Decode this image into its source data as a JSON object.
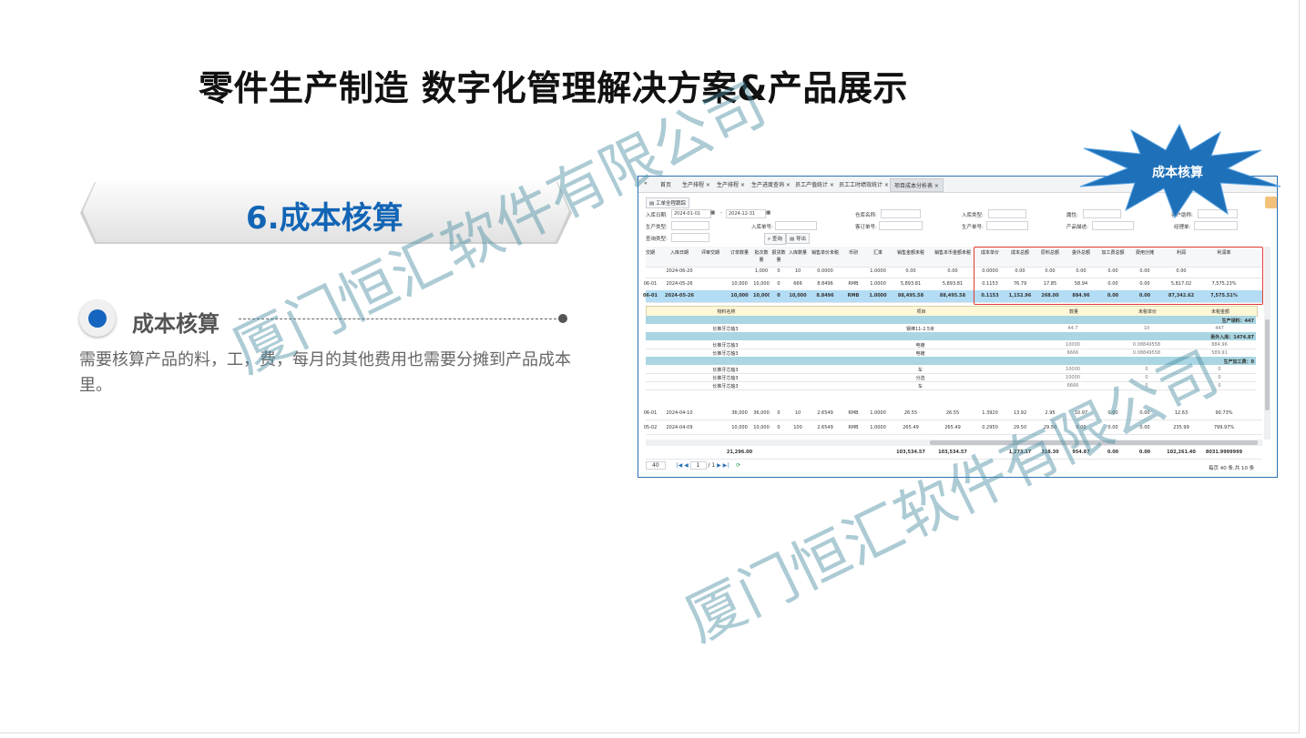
{
  "slide": {
    "title": "零件生产制造 数字化管理解决方案&产品展示",
    "section": "6.成本核算",
    "subheading": "成本核算",
    "description": "需要核算产品的料，工，费，每月的其他费用也需要分摊到产品成本里。",
    "watermark": "厦门恒汇软件有限公司",
    "colors": {
      "corner": "#4a8b94",
      "accent": "#1265b5",
      "highlight_box": "#e23a33",
      "star": "#1e70b8"
    }
  },
  "callout": {
    "label": "成本核算"
  },
  "screenshot": {
    "tabs": [
      "首页",
      "生产排程",
      "生产排程",
      "生产进度查询",
      "员工产值统计",
      "员工工时绩效统计",
      "项目成本分析表"
    ],
    "nav_icon": "«",
    "toolbar_button": "工单全程跟踪",
    "filters": {
      "date_label": "入库日期:",
      "date_from": "2024-01-01",
      "date_to": "2024-12-31",
      "warehouse_label": "仓库名称:",
      "instock_type_label": "入库类型:",
      "attribute_label": "属性:",
      "customer_label": "客户助称:",
      "prod_type_label": "生产类型:",
      "instock_no_label": "入库单号:",
      "order_no_label": "客订单号:",
      "prod_no_label": "生产单号:",
      "product_desc_label": "产品描述:",
      "manager_label": "经理单:",
      "query_type_label": "查询类型:",
      "search_button": "查询",
      "export_button": "导出"
    },
    "columns": [
      "交期",
      "入库日期",
      "评审交期",
      "订单数量",
      "批次数量",
      "报货数量",
      "入库数量",
      "销售单价未税",
      "币别",
      "汇率",
      "销售金额未税",
      "销售本币金额未税",
      "成本单价",
      "成本总额",
      "原料总额",
      "委外总额",
      "加工费总额",
      "费用分摊",
      "利润",
      "利润率"
    ],
    "rows": [
      {
        "cells": [
          "",
          "2024-06-20",
          "",
          "",
          "1,000",
          "0",
          "10",
          "0.0000",
          "",
          "1.0000",
          "0.00",
          "0.00",
          "0.0000",
          "0.00",
          "0.00",
          "0.00",
          "0.00",
          "0.00",
          "0.00",
          ""
        ]
      },
      {
        "cells": [
          "06-01",
          "2024-05-26",
          "",
          "10,000",
          "10,000",
          "0",
          "666",
          "8.8496",
          "RMB",
          "1.0000",
          "5,893.81",
          "5,893.81",
          "0.1153",
          "76.79",
          "17.85",
          "58.94",
          "0.00",
          "0.00",
          "5,817.02",
          "7,575.23%"
        ]
      },
      {
        "cells": [
          "06-01",
          "2024-05-26",
          "",
          "10,000",
          "10,000",
          "0",
          "10,000",
          "8.8496",
          "RMB",
          "1.0000",
          "88,495.58",
          "88,495.58",
          "0.1153",
          "1,152.96",
          "268.00",
          "884.96",
          "0.00",
          "0.00",
          "87,342.62",
          "7,575.51%"
        ]
      }
    ],
    "detail": {
      "headers": [
        "物料名称",
        "项目",
        "数量",
        "未税单价",
        "未税金额"
      ],
      "sections": [
        {
          "title": "生产领料：447",
          "rows": [
            [
              "长推牙芯轴3",
              "钢棒11-2.5米",
              "44.7",
              "10",
              "447"
            ]
          ]
        },
        {
          "title": "委外入库：1474.87",
          "rows": [
            [
              "长推牙芯轴3",
              "电镀",
              "10000",
              "0.08849558",
              "884.96"
            ],
            [
              "长推牙芯轴3",
              "电镀",
              "6666",
              "0.08849558",
              "589.91"
            ]
          ]
        },
        {
          "title": "生产加工费：0",
          "rows": [
            [
              "长推牙芯轴3",
              "车",
              "10000",
              "0",
              "0"
            ],
            [
              "长推牙芯轴3",
              "分选",
              "10000",
              "0",
              "0"
            ],
            [
              "长推牙芯轴3",
              "车",
              "6666",
              "0",
              "0"
            ]
          ]
        }
      ]
    },
    "rows_after": [
      {
        "cells": [
          "06-01",
          "2024-04-10",
          "",
          "36,000",
          "36,000",
          "0",
          "10",
          "2.6549",
          "RMB",
          "1.0000",
          "26.55",
          "26.55",
          "1.3920",
          "13.92",
          "2.95",
          "10.97",
          "0.00",
          "0.00",
          "12.63",
          "90.73%"
        ]
      },
      {
        "cells": [
          "05-02",
          "2024-04-09",
          "",
          "10,000",
          "10,000",
          "0",
          "100",
          "2.6549",
          "RMB",
          "1.0000",
          "265.49",
          "265.49",
          "0.2950",
          "29.50",
          "29.50",
          "0.00",
          "0.00",
          "0.00",
          "235.99",
          "799.97%"
        ]
      }
    ],
    "totals": {
      "cells": [
        "",
        "",
        "",
        "21,296.00",
        "",
        "",
        "",
        "",
        "",
        "",
        "103,534.57",
        "103,534.57",
        "",
        "1,273.17",
        "318.30",
        "954.87",
        "0.00",
        "0.00",
        "102,261.40",
        "8031.9999999"
      ]
    },
    "pager": {
      "page_size": "40",
      "page": "1",
      "of": "/ 1",
      "summary": "每页 40 条,共 10 条"
    }
  }
}
